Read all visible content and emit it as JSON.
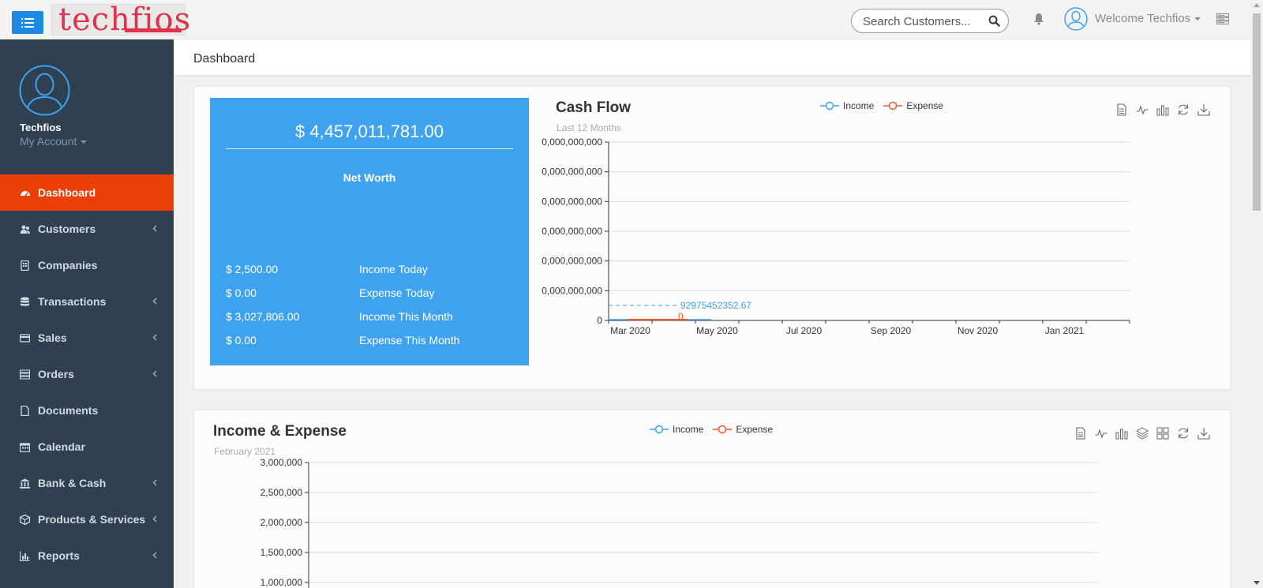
{
  "header": {
    "logo_text": "techfios",
    "search_placeholder": "Search Customers...",
    "welcome": "Welcome Techfios"
  },
  "sidebar": {
    "profile_name": "Techfios",
    "account_label": "My Account",
    "items": [
      {
        "label": "Dashboard",
        "icon": "dashboard-icon",
        "active": true,
        "has_submenu": false
      },
      {
        "label": "Customers",
        "icon": "users-icon",
        "active": false,
        "has_submenu": true
      },
      {
        "label": "Companies",
        "icon": "building-icon",
        "active": false,
        "has_submenu": false
      },
      {
        "label": "Transactions",
        "icon": "database-icon",
        "active": false,
        "has_submenu": true
      },
      {
        "label": "Sales",
        "icon": "credit-card-icon",
        "active": false,
        "has_submenu": true
      },
      {
        "label": "Orders",
        "icon": "server-icon",
        "active": false,
        "has_submenu": true
      },
      {
        "label": "Documents",
        "icon": "file-icon",
        "active": false,
        "has_submenu": false
      },
      {
        "label": "Calendar",
        "icon": "calendar-icon",
        "active": false,
        "has_submenu": false
      },
      {
        "label": "Bank & Cash",
        "icon": "bank-icon",
        "active": false,
        "has_submenu": true
      },
      {
        "label": "Products & Services",
        "icon": "cube-icon",
        "active": false,
        "has_submenu": true
      },
      {
        "label": "Reports",
        "icon": "bar-chart-icon",
        "active": false,
        "has_submenu": true
      }
    ]
  },
  "page": {
    "title": "Dashboard"
  },
  "networth": {
    "amount": "$ 4,457,011,781.00",
    "label": "Net Worth",
    "rows": [
      {
        "value": "$ 2,500.00",
        "label": "Income Today"
      },
      {
        "value": "$ 0.00",
        "label": "Expense Today"
      },
      {
        "value": "$ 3,027,806.00",
        "label": "Income This Month"
      },
      {
        "value": "$ 0.00",
        "label": "Expense This Month"
      }
    ]
  },
  "colors": {
    "income": "#3fa2e6",
    "expense": "#ec5a2c",
    "accent": "#ec3e07",
    "sidebar": "#2f4050",
    "networth_bg": "#3fa2ee"
  },
  "cashflow": {
    "title": "Cash Flow",
    "subtitle": "Last 12 Months",
    "legend": [
      "Income",
      "Expense"
    ],
    "toolbox": [
      "data-view-icon",
      "line-chart-icon",
      "bar-chart-icon",
      "refresh-icon",
      "download-icon"
    ]
  },
  "income_expense": {
    "title": "Income & Expense",
    "subtitle": "February 2021",
    "legend": [
      "Income",
      "Expense"
    ],
    "toolbox": [
      "data-view-icon",
      "line-chart-icon",
      "bar-chart-icon",
      "stack-icon",
      "tiled-icon",
      "refresh-icon",
      "download-icon"
    ]
  },
  "chart_data": [
    {
      "type": "line",
      "x_tick_labels": [
        "Mar 2020",
        "May 2020",
        "Jul 2020",
        "Sep 2020",
        "Nov 2020",
        "Jan 2021"
      ],
      "y_tick_labels": [
        "0",
        "0,000,000,000",
        "0,000,000,000",
        "0,000,000,000",
        "0,000,000,000",
        "0,000,000,000",
        "0,000,000,000"
      ],
      "series": [
        {
          "name": "Income",
          "markline_label": "92975452352.67"
        },
        {
          "name": "Expense",
          "markline_label": "0"
        }
      ],
      "grid": true,
      "legend_position": "top-center"
    },
    {
      "type": "line",
      "y_tick_labels": [
        "3,000,000",
        "2,500,000",
        "2,000,000",
        "1,500,000",
        "1,000,000"
      ],
      "ylim": [
        1000000,
        3000000
      ],
      "series": [
        {
          "name": "Income"
        },
        {
          "name": "Expense"
        }
      ],
      "grid": true,
      "legend_position": "top-center"
    }
  ]
}
